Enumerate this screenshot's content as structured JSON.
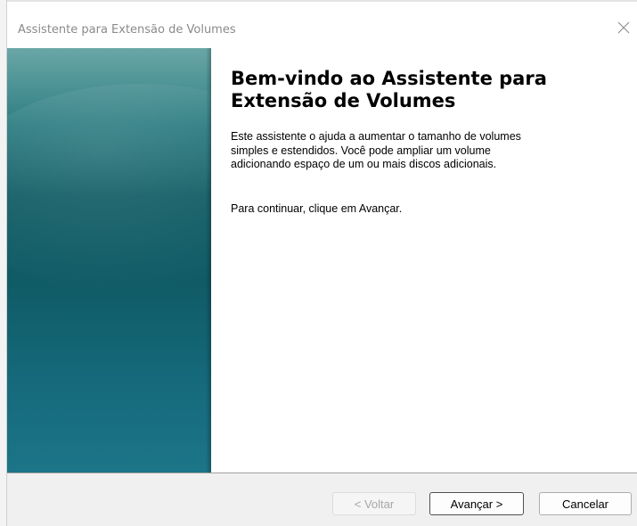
{
  "window": {
    "title": "Assistente para Extensão de Volumes"
  },
  "welcome": {
    "heading": "Bem-vindo ao Assistente para\nExtensão de Volumes",
    "description": "Este assistente o ajuda a aumentar o tamanho de volumes\nsimples e estendidos. Você pode ampliar um volume\nadicionando espaço de um ou mais discos adicionais.",
    "continue_hint": "Para continuar, clique em Avançar."
  },
  "buttons": {
    "back": "< Voltar",
    "next": "Avançar >",
    "cancel": "Cancelar"
  },
  "icons": {
    "close": "close-icon"
  },
  "colors": {
    "side_panel": "#0f5b66",
    "footer": "#f0f0f0",
    "title_text": "#8a8a8a"
  }
}
